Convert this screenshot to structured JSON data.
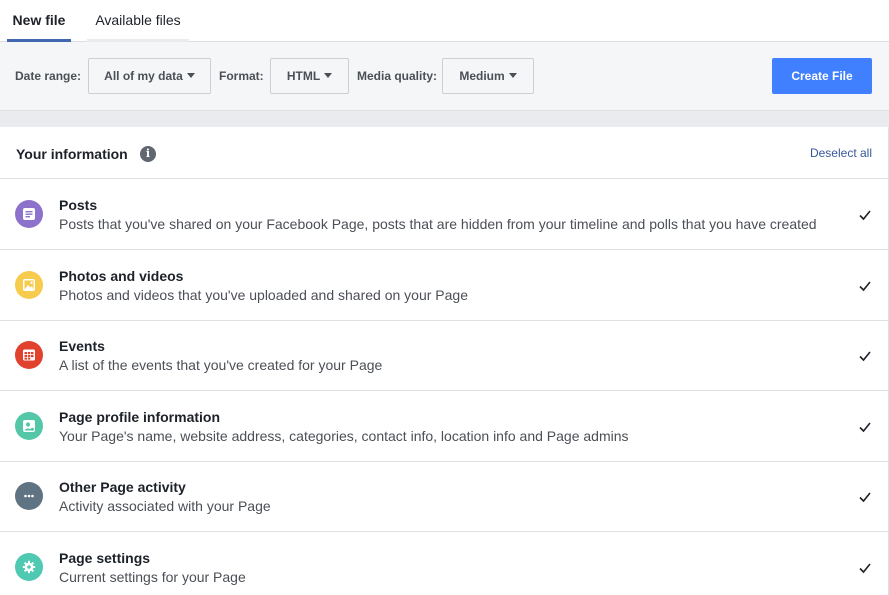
{
  "tabs": [
    {
      "label": "New file"
    },
    {
      "label": "Available files"
    }
  ],
  "toolbar": {
    "date_range_label": "Date range:",
    "date_range_value": "All of my data",
    "format_label": "Format:",
    "format_value": "HTML",
    "media_quality_label": "Media quality:",
    "media_quality_value": "Medium",
    "create_button": "Create File"
  },
  "panel": {
    "title": "Your information",
    "info_icon_glyph": "i",
    "deselect_all": "Deselect all"
  },
  "items": [
    {
      "title": "Posts",
      "description": "Posts that you've shared on your Facebook Page, posts that are hidden from your timeline and polls that you have created",
      "icon": "posts-icon",
      "color": "#8c72cb",
      "checked": true
    },
    {
      "title": "Photos and videos",
      "description": "Photos and videos that you've uploaded and shared on your Page",
      "icon": "photos-icon",
      "color": "#f7cb4d",
      "checked": true
    },
    {
      "title": "Events",
      "description": "A list of the events that you've created for your Page",
      "icon": "calendar-icon",
      "color": "#e0422d",
      "checked": true
    },
    {
      "title": "Page profile information",
      "description": "Your Page's name, website address, categories, contact info, location info and Page admins",
      "icon": "profile-icon",
      "color": "#54c7a9",
      "checked": true
    },
    {
      "title": "Other Page activity",
      "description": "Activity associated with your Page",
      "icon": "more-icon",
      "color": "#5f7383",
      "checked": true
    },
    {
      "title": "Page settings",
      "description": "Current settings for your Page",
      "icon": "settings-gear-icon",
      "color": "#4fc9b2",
      "checked": true
    }
  ],
  "colors": {
    "accent": "#4267b2",
    "button": "#4080ff",
    "link": "#365899"
  }
}
